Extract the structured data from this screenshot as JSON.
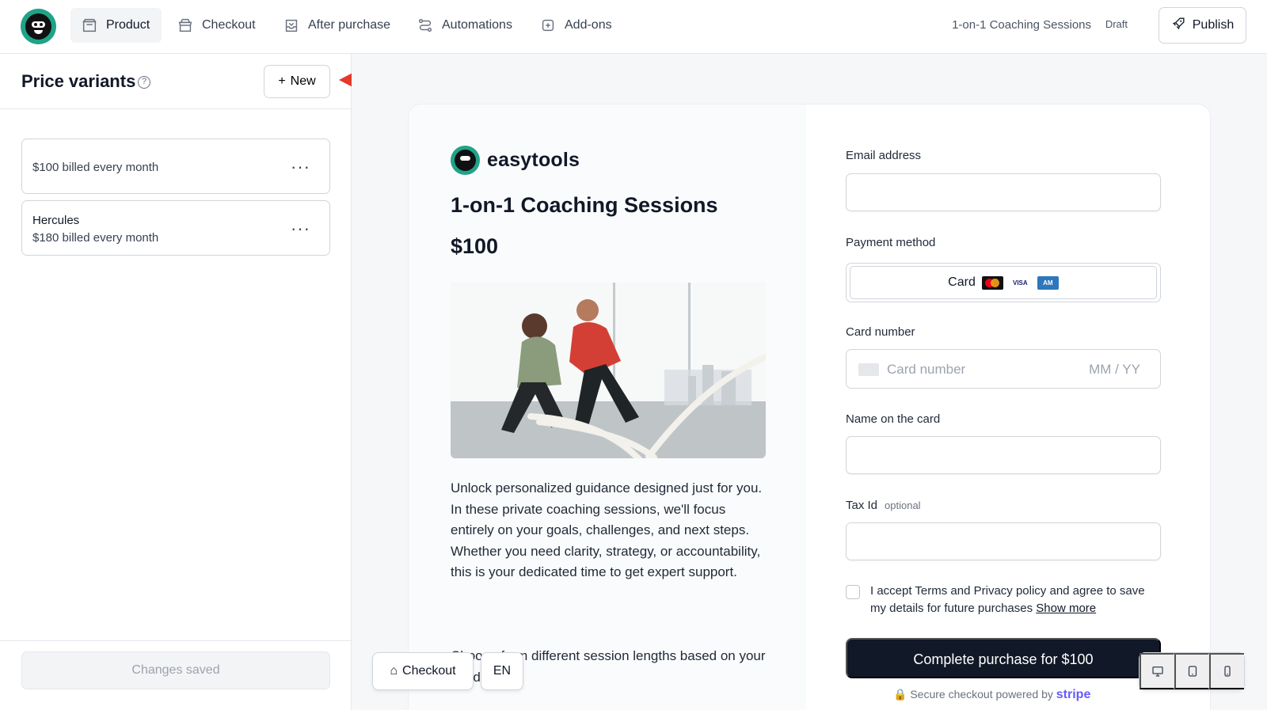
{
  "header": {
    "nav": [
      {
        "label": "Product",
        "icon": "box-icon",
        "active": true
      },
      {
        "label": "Checkout",
        "icon": "store-icon",
        "active": false
      },
      {
        "label": "After purchase",
        "icon": "inbox-icon",
        "active": false
      },
      {
        "label": "Automations",
        "icon": "workflow-icon",
        "active": false
      },
      {
        "label": "Add-ons",
        "icon": "plus-square-icon",
        "active": false
      }
    ],
    "product_name": "1-on-1 Coaching Sessions",
    "status": "Draft",
    "publish_label": "Publish"
  },
  "sidebar": {
    "title": "Price variants",
    "new_label": "New",
    "variants": [
      {
        "name": "",
        "description": "$100 billed every month"
      },
      {
        "name": "Hercules",
        "description": "$180 billed every month"
      }
    ],
    "save_status": "Changes saved"
  },
  "preview": {
    "brand": "easytools",
    "title": "1-on-1 Coaching Sessions",
    "price": "$100",
    "description": "Unlock personalized guidance designed just for you. In these private coaching sessions, we'll focus entirely on your goals, challenges, and next steps. Whether you need clarity, strategy, or accountability, this is your dedicated time to get expert support.",
    "description_more": "Choose from different session lengths based on your needs:",
    "form": {
      "email_label": "Email address",
      "payment_label": "Payment method",
      "payment_option": "Card",
      "card_number_label": "Card number",
      "card_number_placeholder": "Card number",
      "expiry_placeholder": "MM / YY",
      "name_label": "Name on the card",
      "tax_label": "Tax Id",
      "tax_optional": "optional",
      "terms_text": "I accept Terms and Privacy policy and agree to save my details for future purchases",
      "show_more": "Show more",
      "purchase_button": "Complete purchase for $100",
      "secure_text": "Secure checkout powered by",
      "stripe": "stripe"
    }
  },
  "controls": {
    "checkout_view": "Checkout",
    "language": "EN"
  },
  "colors": {
    "brand_green": "#1fa389",
    "primary_button": "#111827",
    "stripe_purple": "#635bff",
    "annotation_arrow": "#e5392b"
  }
}
